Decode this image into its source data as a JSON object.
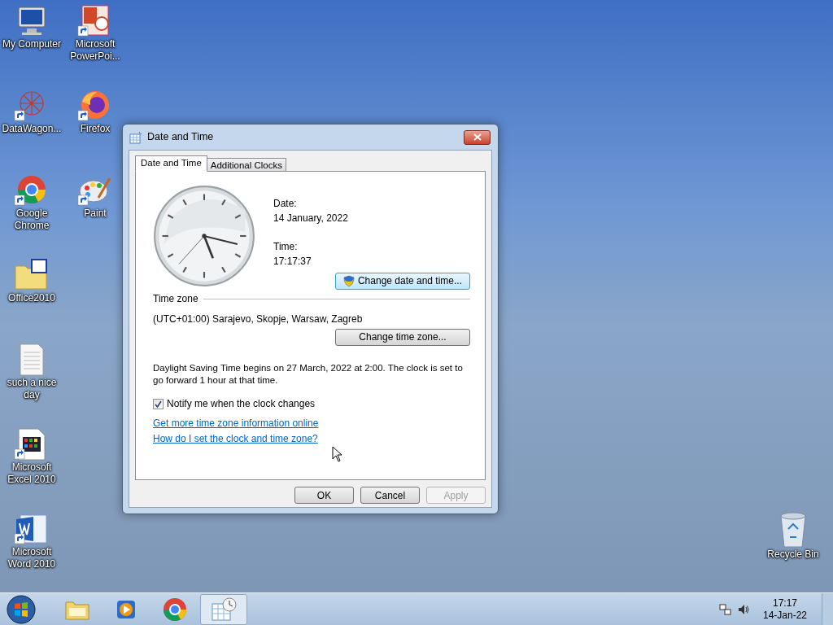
{
  "desktop_icons": [
    {
      "label": "My Computer",
      "kind": "computer",
      "shortcut": false
    },
    {
      "label": "DataWagon...",
      "kind": "network",
      "shortcut": true
    },
    {
      "label": "Google Chrome",
      "kind": "browser-round",
      "shortcut": true
    },
    {
      "label": "Office2010",
      "kind": "iso-folder",
      "shortcut": false
    },
    {
      "label": "such a nice day",
      "kind": "text-file",
      "shortcut": false
    },
    {
      "label": "Microsoft Excel 2010",
      "kind": "spreadsheet",
      "shortcut": true
    },
    {
      "label": "Microsoft Word 2010",
      "kind": "word-doc",
      "shortcut": true
    },
    {
      "label": "Microsoft PowerPoi...",
      "kind": "slides",
      "shortcut": true
    },
    {
      "label": "Firefox",
      "kind": "browser-fox",
      "shortcut": true
    },
    {
      "label": "Paint",
      "kind": "palette",
      "shortcut": true
    }
  ],
  "recycle_bin": {
    "label": "Recycle Bin"
  },
  "dialog": {
    "title": "Date and Time",
    "tabs": [
      {
        "label": "Date and Time",
        "selected": true
      },
      {
        "label": "Additional Clocks",
        "selected": false
      }
    ],
    "date_label": "Date:",
    "date_value": "14 January, 2022",
    "time_label": "Time:",
    "time_value": "17:17:37",
    "change_date_button": {
      "label": "Change date and time...",
      "focused": true
    },
    "time_zone_heading": "Time zone",
    "time_zone_value": "(UTC+01:00) Sarajevo, Skopje, Warsaw, Zagreb",
    "change_zone_button": {
      "label": "Change time zone...",
      "focused": false
    },
    "dst_note": "Daylight Saving Time begins on 27 March, 2022 at 2:00. The clock is set to go forward 1 hour at that time.",
    "notify_checkbox": {
      "label": "Notify me when the clock changes",
      "checked": true
    },
    "links": [
      "Get more time zone information online",
      "How do I set the clock and time zone?"
    ],
    "buttons": [
      {
        "label": "OK",
        "disabled": false
      },
      {
        "label": "Cancel",
        "disabled": false
      },
      {
        "label": "Apply",
        "disabled": true
      }
    ]
  },
  "taskbar": {
    "items": [
      {
        "kind": "folder",
        "selected": false
      },
      {
        "kind": "media",
        "selected": false
      },
      {
        "kind": "browser",
        "selected": false
      },
      {
        "kind": "calendar",
        "selected": true
      }
    ],
    "time": "17:17",
    "date": "14-Jan-22"
  }
}
